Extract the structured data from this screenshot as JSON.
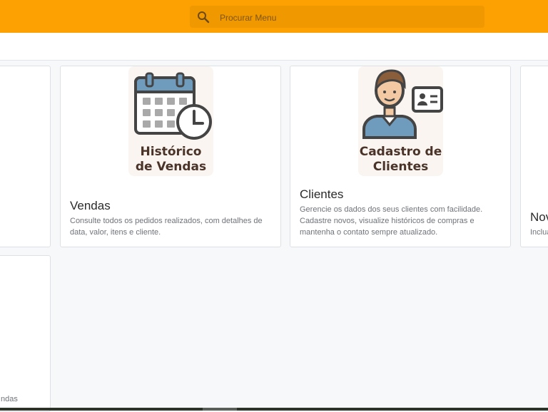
{
  "search": {
    "placeholder": "Procurar Menu"
  },
  "cards": {
    "vendas": {
      "illustration_line1": "Histórico",
      "illustration_line2": "de Vendas",
      "title": "Vendas",
      "description": "Consulte todos os pedidos realizados, com detalhes de data, valor, itens e cliente."
    },
    "clientes": {
      "illustration_line1": "Cadastro de",
      "illustration_line2": "Clientes",
      "title": "Clientes",
      "description": "Gerencie os dados dos seus clientes com facilidade. Cadastre novos, visualize históricos de compras e mantenha o contato sempre atualizado."
    },
    "partial_right": {
      "title": "Nov",
      "description": "Inclua"
    },
    "partial_bottom_left": {
      "description": "ndas"
    }
  },
  "colors": {
    "topbar": "#fda102",
    "search_bg": "#ef9800",
    "background": "#f7f8fa"
  }
}
